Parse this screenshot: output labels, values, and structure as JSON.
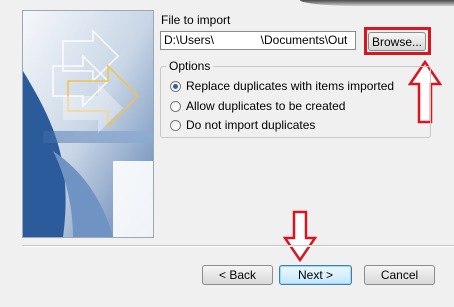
{
  "file": {
    "label": "File to import",
    "path": "D:\\Users\\              \\Documents\\Out",
    "browse_label": "Browse..."
  },
  "options": {
    "legend": "Options",
    "items": [
      {
        "label": "Replace duplicates with items imported",
        "checked": true
      },
      {
        "label": "Allow duplicates to be created",
        "checked": false
      },
      {
        "label": "Do not import duplicates",
        "checked": false
      }
    ]
  },
  "buttons": {
    "back": "< Back",
    "next": "Next >",
    "cancel": "Cancel"
  },
  "colors": {
    "highlight": "#d9151f",
    "accent": "#2a5db0"
  }
}
